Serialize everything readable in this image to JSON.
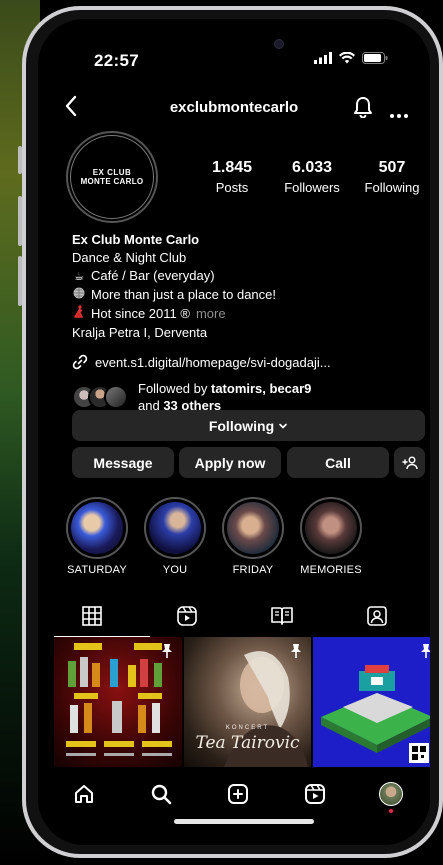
{
  "status_bar": {
    "time": "22:57"
  },
  "header": {
    "username": "exclubmontecarlo"
  },
  "profile": {
    "avatar_logo_line1": "EX CLUB",
    "avatar_logo_line2": "MONTE CARLO",
    "stats": [
      {
        "value": "1.845",
        "label": "Posts"
      },
      {
        "value": "6.033",
        "label": "Followers"
      },
      {
        "value": "507",
        "label": "Following"
      }
    ],
    "bio": {
      "name": "Ex Club Monte Carlo",
      "category": "Dance & Night Club",
      "lines": [
        {
          "icon": "coffee-cup-icon",
          "glyph": "☕",
          "text": "Café / Bar (everyday)"
        },
        {
          "icon": "disco-ball-icon",
          "glyph": "●",
          "text": "More than just a place to dance!"
        },
        {
          "icon": "dancer-icon",
          "glyph": "💃",
          "text": "Hot since 2011 ®"
        }
      ],
      "more_label": "more",
      "address": "Kralja Petra I, Derventa"
    },
    "link": "event.s1.digital/homepage/svi-dogadaji...",
    "followed_by": {
      "prefix": "Followed by ",
      "names": "tatomirs, becar9",
      "and_label": "and ",
      "others": "33 others"
    }
  },
  "buttons": {
    "following": "Following",
    "message": "Message",
    "apply_now": "Apply now",
    "call": "Call"
  },
  "highlights": [
    {
      "label": "SATURDAY"
    },
    {
      "label": "YOU"
    },
    {
      "label": "FRIDAY"
    },
    {
      "label": "MEMORIES"
    }
  ],
  "colors": {
    "background": "#000000",
    "button_bg": "#262626",
    "muted_text": "#8e8e8e",
    "notification_dot": "#e2264d"
  },
  "posts": [
    {
      "name": "drinks-menu-post",
      "pinned": true
    },
    {
      "name": "koncert-tea-tairovic-post",
      "pinned": true,
      "caption_top": "KONCERT",
      "caption_name": "Tea Tairovic"
    },
    {
      "name": "club-floorplan-post",
      "pinned": true
    }
  ]
}
